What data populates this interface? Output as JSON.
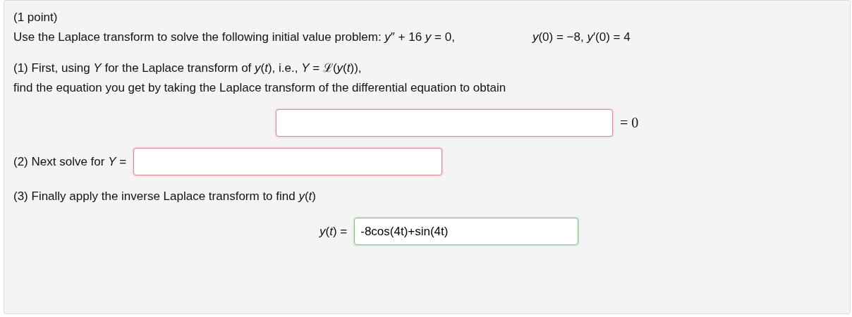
{
  "points": "(1 point)",
  "statement": "Use the Laplace transform to solve the following initial value problem: *y*″ + 16 *y* = 0,",
  "initial_conditions": "*y*(0) = −8,  *y*′(0) = 4",
  "parts": [
    {
      "kind": "centered",
      "lines": [
        "(1) First, using *Y* for the Laplace transform of *y*(*t*), i.e., *Y* = ℒ(*y*(*t*)),",
        "find the equation you get by taking the Laplace transform of the differential equation to obtain"
      ],
      "answer": {
        "correct": false
      },
      "suffix": "= 0"
    },
    {
      "kind": "inline",
      "lines": [
        "(2) Next solve for *Y* ="
      ],
      "answer": {
        "correct": false
      }
    },
    {
      "kind": "labeled",
      "lines": [
        "(3) Finally apply the inverse Laplace transform to find *y*(*t*)"
      ],
      "label": "*y*(*t*) =",
      "answer": {
        "value": "-8cos(4t)+sin(4t)",
        "correct": true
      }
    }
  ]
}
